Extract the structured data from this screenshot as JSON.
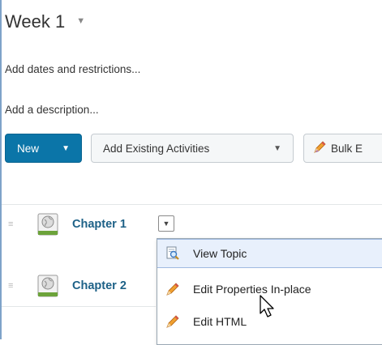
{
  "header": {
    "title": "Week 1",
    "title_menu_icon": "caret-down-icon"
  },
  "module": {
    "add_dates_link": "Add dates and restrictions...",
    "add_description_link": "Add a description..."
  },
  "toolbar": {
    "new_label": "New",
    "add_existing_label": "Add Existing Activities",
    "bulk_edit_label": "Bulk E",
    "accent_color": "#0b75a8"
  },
  "topics": [
    {
      "title": "Chapter 1",
      "icon": "globe-topic-icon"
    },
    {
      "title": "Chapter 2",
      "icon": "globe-topic-icon"
    }
  ],
  "context_menu": {
    "items": [
      {
        "label": "View Topic",
        "icon": "magnifier-page-icon",
        "state": "hover"
      },
      {
        "label": "Edit Properties In-place",
        "icon": "pencil-icon"
      },
      {
        "label": "Edit HTML",
        "icon": "pencil-icon"
      }
    ]
  }
}
